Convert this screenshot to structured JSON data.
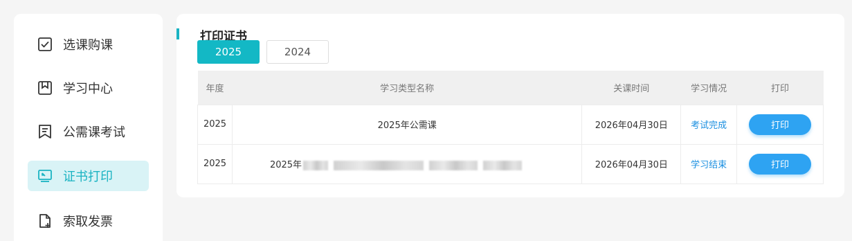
{
  "sidebar": {
    "items": [
      {
        "label": "选课购课",
        "icon": "checkbox-icon",
        "active": false
      },
      {
        "label": "学习中心",
        "icon": "bookmark-icon",
        "active": false
      },
      {
        "label": "公需课考试",
        "icon": "exam-icon",
        "active": false
      },
      {
        "label": "证书打印",
        "icon": "monitor-certificate-icon",
        "active": true
      },
      {
        "label": "索取发票",
        "icon": "file-plus-icon",
        "active": false
      }
    ]
  },
  "main": {
    "title": "打印证书",
    "year_tabs": [
      {
        "label": "2025",
        "active": true
      },
      {
        "label": "2024",
        "active": false
      }
    ],
    "table": {
      "headers": [
        "年度",
        "学习类型名称",
        "关课时间",
        "学习情况",
        "打印"
      ],
      "rows": [
        {
          "year": "2025",
          "name": "2025年公需课",
          "close_time": "2026年04月30日",
          "status": "考试完成",
          "action": "打印"
        },
        {
          "year": "2025",
          "name": "2025年",
          "close_time": "2026年04月30日",
          "status": "学习结束",
          "action": "打印"
        }
      ]
    }
  },
  "colors": {
    "accent": "#13b8c5",
    "active_nav_bg": "#d9f3f6",
    "print_button": "#2ea3f2",
    "status_link": "#1a8fe0"
  }
}
